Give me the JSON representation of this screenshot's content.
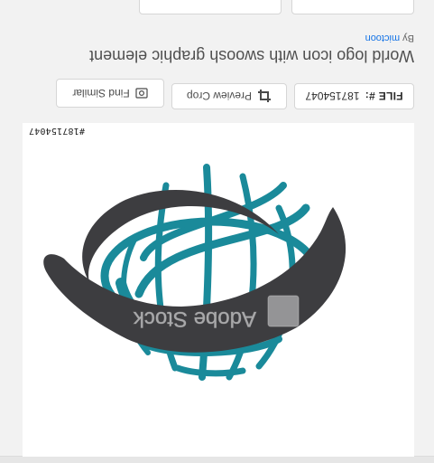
{
  "file": {
    "label": "FILE #:",
    "number": "187154047"
  },
  "actions": {
    "preview_crop": "Preview Crop",
    "find_similar": "Find Similar"
  },
  "asset": {
    "title": "World logo icon with swoosh graphic element",
    "by_prefix": "By",
    "author": "mictoon",
    "watermark": "Adobe Stock",
    "stamp": "#187154047"
  },
  "colors": {
    "globe_teal": "#1a8a9a",
    "swoosh_gray": "#3d3d40",
    "link_blue": "#1473e6"
  }
}
